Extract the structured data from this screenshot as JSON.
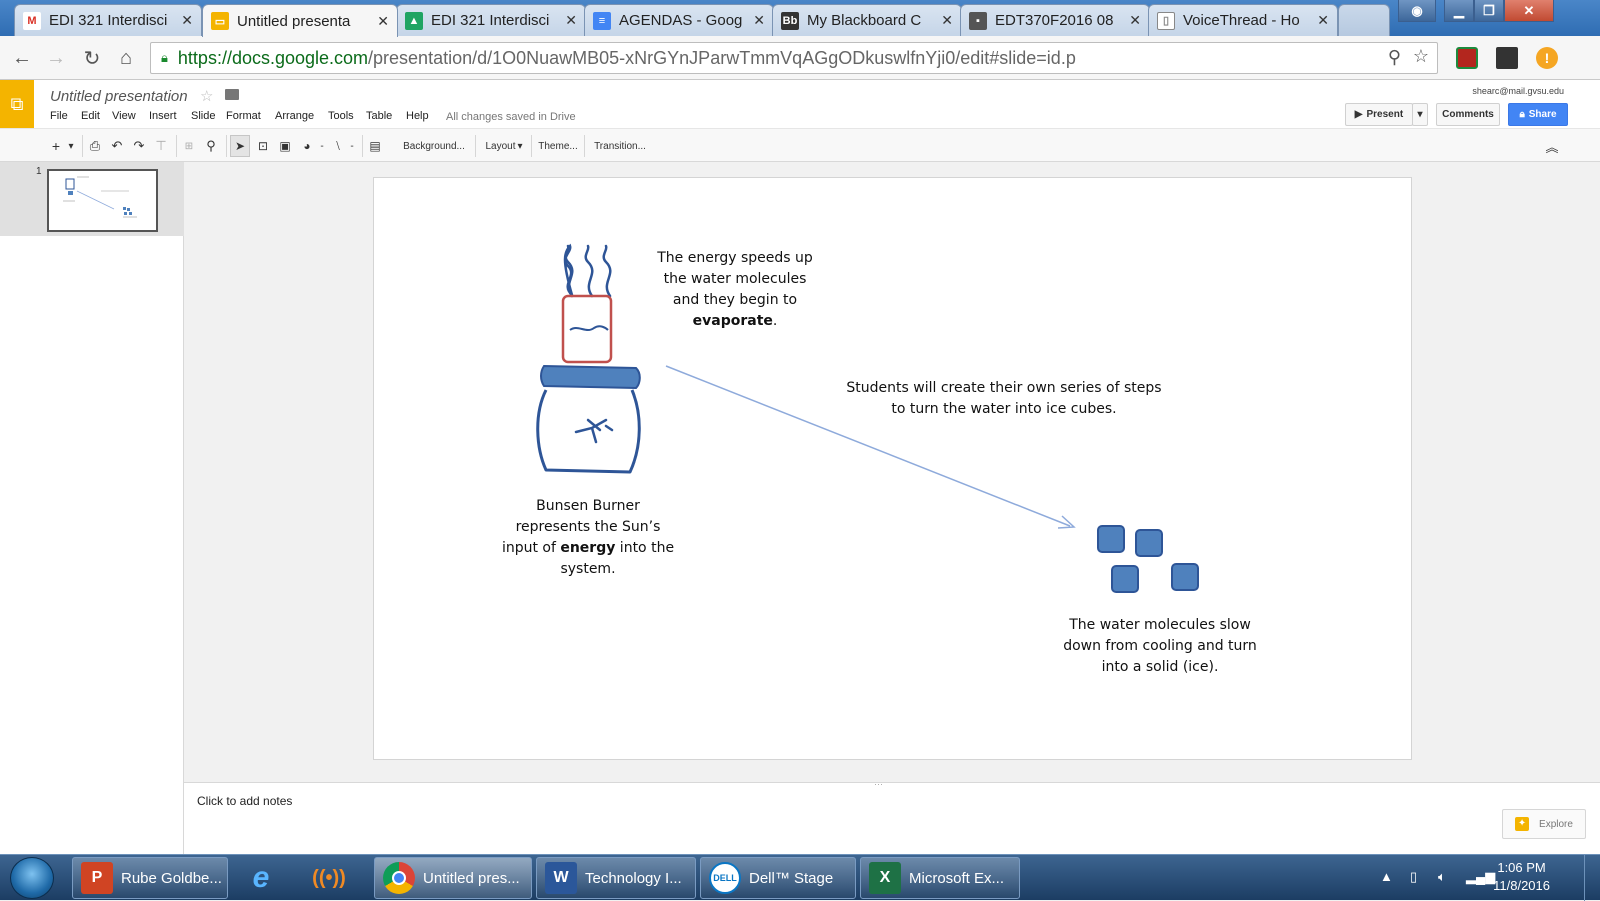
{
  "browser": {
    "tabs": [
      {
        "title": "EDI 321 Interdisci",
        "icon": "gmail-icon",
        "color": "#d93025"
      },
      {
        "title": "Untitled presenta",
        "icon": "slides-icon",
        "color": "#f4b400"
      },
      {
        "title": "EDI 321 Interdisci",
        "icon": "drive-icon",
        "color": "#1fa463"
      },
      {
        "title": "AGENDAS - Goog",
        "icon": "docs-icon",
        "color": "#4285f4"
      },
      {
        "title": "My Blackboard C",
        "icon": "blackboard-icon",
        "color": "#333333"
      },
      {
        "title": "EDT370F2016 08",
        "icon": "profile-icon",
        "color": "#555555"
      },
      {
        "title": "VoiceThread - Ho",
        "icon": "page-icon",
        "color": "#888888"
      }
    ],
    "url_host": "https://docs.google.com",
    "url_rest": "/presentation/d/1O0NuawMB05-xNrGYnJParwTmmVqAGgODkuswlfnYji0/edit#slide=id.p"
  },
  "docs": {
    "title": "Untitled presentation",
    "menus": [
      "File",
      "Edit",
      "View",
      "Insert",
      "Slide",
      "Format",
      "Arrange",
      "Tools",
      "Table",
      "Help"
    ],
    "saved_status": "All changes saved in Drive",
    "account": "shearc@mail.gvsu.edu",
    "present_label": "Present",
    "comments_label": "Comments",
    "share_label": "Share"
  },
  "toolbar": {
    "background_label": "Background...",
    "layout_label": "Layout",
    "theme_label": "Theme...",
    "transition_label": "Transition..."
  },
  "filmstrip": {
    "slide_number": "1"
  },
  "slide": {
    "text_evaporate_1": "The energy speeds up",
    "text_evaporate_2": "the water molecules",
    "text_evaporate_3": "and they begin to",
    "text_evaporate_bold": "evaporate",
    "text_students_1": "Students  will create their own series of steps",
    "text_students_2": "to turn  the water into ice cubes.",
    "text_burner_1": "Bunsen Burner",
    "text_burner_2": "represents the Sun’s",
    "text_burner_3a": "input of ",
    "text_burner_bold": "energy",
    "text_burner_3b": " into the",
    "text_burner_4": "system.",
    "text_ice_1": "The water molecules slow",
    "text_ice_2": "down from cooling and turn",
    "text_ice_3": "into a solid (ice).",
    "colors": {
      "burner_blue": "#2e5597",
      "beaker_red": "#c0504d",
      "cube_fill": "#4f81bd",
      "arrow": "#8eaadb"
    }
  },
  "notes": {
    "placeholder": "Click to add notes",
    "explore_label": "Explore"
  },
  "taskbar": {
    "items": [
      {
        "label": "Rube Goldbe...",
        "icon": "powerpoint-icon",
        "color": "#d04423"
      },
      {
        "label": "",
        "icon": "internet-explorer-icon",
        "color": "#1e90ff"
      },
      {
        "label": "",
        "icon": "wireless-icon",
        "color": "#e87b1e"
      },
      {
        "label": "Untitled pres...",
        "icon": "chrome-icon",
        "color": "#4285f4"
      },
      {
        "label": "Technology I...",
        "icon": "word-icon",
        "color": "#2b579a"
      },
      {
        "label": "Dell™ Stage",
        "icon": "dell-icon",
        "color": "#0a76c4"
      },
      {
        "label": "Microsoft Ex...",
        "icon": "excel-icon",
        "color": "#1e7145"
      }
    ],
    "time": "1:06 PM",
    "date": "11/8/2016"
  }
}
